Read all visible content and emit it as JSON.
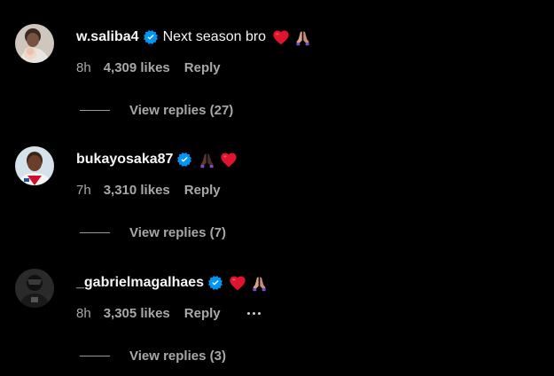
{
  "colors": {
    "background": "#000000",
    "primary_text": "#f5f5f5",
    "secondary_text": "#a8a8a8",
    "verified_blue": "#0095f6"
  },
  "comments": [
    {
      "username": "w.saliba4",
      "text": "Next season bro",
      "emojis": [
        "heart-icon",
        "praying-hands-icon"
      ],
      "time": "8h",
      "likes": "4,309 likes",
      "reply_label": "Reply",
      "view_replies": "View replies (27)"
    },
    {
      "username": "bukayosaka87",
      "text": "",
      "emojis": [
        "praying-hands-icon",
        "heart-icon"
      ],
      "time": "7h",
      "likes": "3,310 likes",
      "reply_label": "Reply",
      "view_replies": "View replies (7)"
    },
    {
      "username": "_gabrielmagalhaes",
      "text": "",
      "emojis": [
        "heart-icon",
        "praying-hands-icon"
      ],
      "time": "8h",
      "likes": "3,305 likes",
      "reply_label": "Reply",
      "more_icon": "more-options-icon",
      "view_replies": "View replies (3)"
    }
  ]
}
